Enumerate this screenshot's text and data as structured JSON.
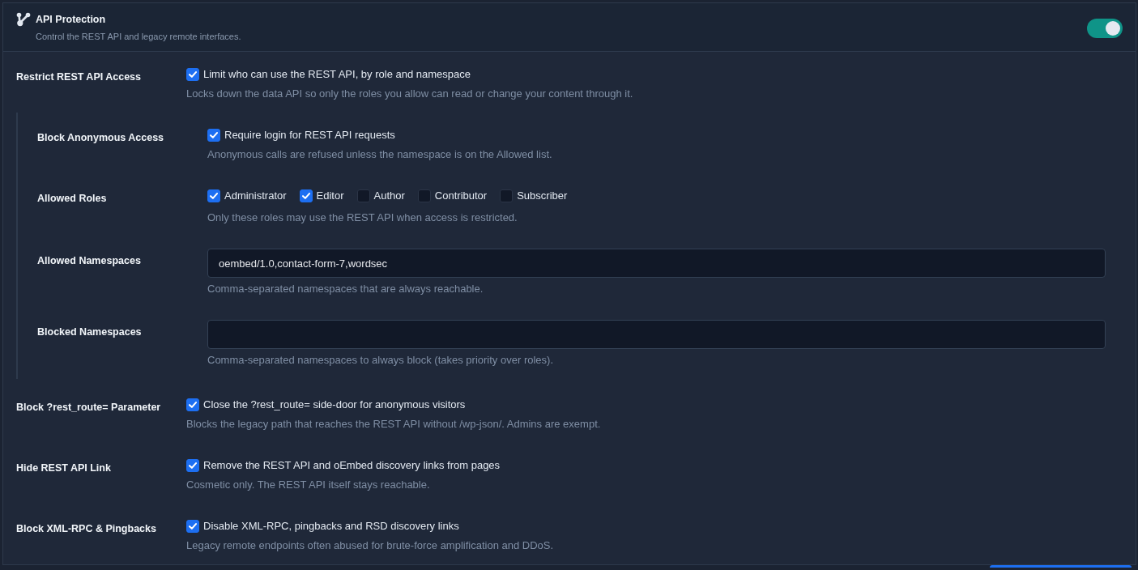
{
  "section": {
    "title": "API Protection",
    "subtitle": "Control the REST API and legacy remote interfaces.",
    "enabled": true
  },
  "settings": [
    {
      "kind": "checkbox",
      "label": "Restrict REST API Access",
      "option": {
        "label": "Limit who can use the REST API, by role and namespace",
        "checked": true
      },
      "description": "Locks down the data API so only the roles you allow can read or change your content through it.",
      "children": [
        {
          "kind": "checkbox",
          "label": "Block Anonymous Access",
          "option": {
            "label": "Require login for REST API requests",
            "checked": true
          },
          "description": "Anonymous calls are refused unless the namespace is on the Allowed list."
        },
        {
          "kind": "checkbox_group",
          "label": "Allowed Roles",
          "options": [
            {
              "label": "Administrator",
              "checked": true
            },
            {
              "label": "Editor",
              "checked": true
            },
            {
              "label": "Author",
              "checked": false
            },
            {
              "label": "Contributor",
              "checked": false
            },
            {
              "label": "Subscriber",
              "checked": false
            }
          ],
          "description": "Only these roles may use the REST API when access is restricted."
        },
        {
          "kind": "text",
          "label": "Allowed Namespaces",
          "value": "oembed/1.0,contact-form-7,wordsec",
          "description": "Comma-separated namespaces that are always reachable."
        },
        {
          "kind": "text",
          "label": "Blocked Namespaces",
          "description": "Comma-separated namespaces to always block (takes priority over roles)."
        }
      ]
    },
    {
      "kind": "checkbox",
      "label": "Block ?rest_route= Parameter",
      "option": {
        "label": "Close the ?rest_route= side-door for anonymous visitors",
        "checked": true
      },
      "description": "Blocks the legacy path that reaches the REST API without /wp-json/. Admins are exempt."
    },
    {
      "kind": "checkbox",
      "label": "Hide REST API Link",
      "option": {
        "label": "Remove the REST API and oEmbed discovery links from pages",
        "checked": true
      },
      "description": "Cosmetic only. The REST API itself stays reachable."
    },
    {
      "kind": "checkbox",
      "label": "Block XML-RPC & Pingbacks",
      "option": {
        "label": "Disable XML-RPC, pingbacks and RSD discovery links",
        "checked": true
      },
      "description": "Legacy remote endpoints often abused for brute-force amplification and DDoS."
    }
  ]
}
